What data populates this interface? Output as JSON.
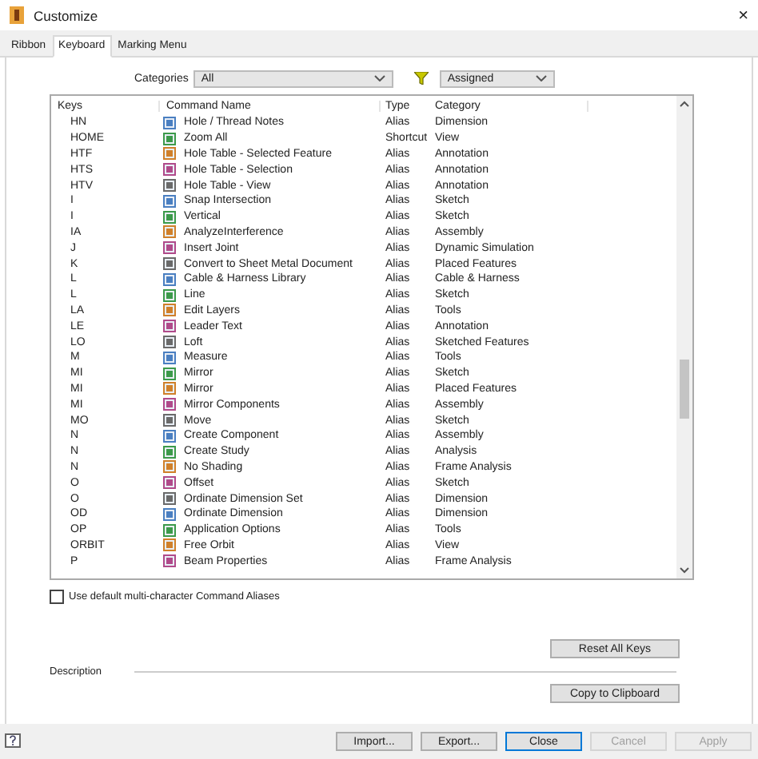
{
  "window": {
    "title": "Customize",
    "close": "×"
  },
  "tabs": [
    {
      "label": "Ribbon",
      "selected": false
    },
    {
      "label": "Keyboard",
      "selected": true
    },
    {
      "label": "Marking Menu",
      "selected": false
    }
  ],
  "categories": {
    "label": "Categories",
    "value": "All"
  },
  "filter": {
    "value": "Assigned"
  },
  "table": {
    "columns": [
      "Keys",
      "Command Name",
      "Type",
      "Category"
    ],
    "rows": [
      {
        "keys": "HN",
        "command": "Hole / Thread Notes",
        "type": "Alias",
        "category": "Dimension"
      },
      {
        "keys": "HOME",
        "command": "Zoom All",
        "type": "Shortcut",
        "category": "View"
      },
      {
        "keys": "HTF",
        "command": "Hole Table - Selected Feature",
        "type": "Alias",
        "category": "Annotation"
      },
      {
        "keys": "HTS",
        "command": "Hole Table - Selection",
        "type": "Alias",
        "category": "Annotation"
      },
      {
        "keys": "HTV",
        "command": "Hole Table - View",
        "type": "Alias",
        "category": "Annotation"
      },
      {
        "keys": "I",
        "command": "Snap Intersection",
        "type": "Alias",
        "category": "Sketch"
      },
      {
        "keys": "I",
        "command": "Vertical",
        "type": "Alias",
        "category": "Sketch"
      },
      {
        "keys": "IA",
        "command": "AnalyzeInterference",
        "type": "Alias",
        "category": "Assembly"
      },
      {
        "keys": "J",
        "command": "Insert Joint",
        "type": "Alias",
        "category": "Dynamic Simulation"
      },
      {
        "keys": "K",
        "command": "Convert to Sheet Metal Document",
        "type": "Alias",
        "category": "Placed Features"
      },
      {
        "keys": "L",
        "command": "Cable & Harness Library",
        "type": "Alias",
        "category": "Cable & Harness"
      },
      {
        "keys": "L",
        "command": "Line",
        "type": "Alias",
        "category": "Sketch"
      },
      {
        "keys": "LA",
        "command": "Edit Layers",
        "type": "Alias",
        "category": "Tools"
      },
      {
        "keys": "LE",
        "command": "Leader Text",
        "type": "Alias",
        "category": "Annotation"
      },
      {
        "keys": "LO",
        "command": "Loft",
        "type": "Alias",
        "category": "Sketched Features"
      },
      {
        "keys": "M",
        "command": "Measure",
        "type": "Alias",
        "category": "Tools"
      },
      {
        "keys": "MI",
        "command": "Mirror",
        "type": "Alias",
        "category": "Sketch"
      },
      {
        "keys": "MI",
        "command": "Mirror",
        "type": "Alias",
        "category": "Placed Features"
      },
      {
        "keys": "MI",
        "command": "Mirror Components",
        "type": "Alias",
        "category": "Assembly"
      },
      {
        "keys": "MO",
        "command": "Move",
        "type": "Alias",
        "category": "Sketch"
      },
      {
        "keys": "N",
        "command": "Create Component",
        "type": "Alias",
        "category": "Assembly"
      },
      {
        "keys": "N",
        "command": "Create Study",
        "type": "Alias",
        "category": "Analysis"
      },
      {
        "keys": "N",
        "command": "No Shading",
        "type": "Alias",
        "category": "Frame Analysis"
      },
      {
        "keys": "O",
        "command": "Offset",
        "type": "Alias",
        "category": "Sketch"
      },
      {
        "keys": "O",
        "command": "Ordinate Dimension Set",
        "type": "Alias",
        "category": "Dimension"
      },
      {
        "keys": "OD",
        "command": "Ordinate Dimension",
        "type": "Alias",
        "category": "Dimension"
      },
      {
        "keys": "OP",
        "command": "Application Options",
        "type": "Alias",
        "category": "Tools"
      },
      {
        "keys": "ORBIT",
        "command": "Free Orbit",
        "type": "Alias",
        "category": "View"
      },
      {
        "keys": "P",
        "command": "Beam Properties",
        "type": "Alias",
        "category": "Frame Analysis"
      }
    ]
  },
  "default_aliases": {
    "label": "Use default multi-character Command Aliases",
    "checked": false
  },
  "reset_button": "Reset All Keys",
  "description": {
    "label": "Description"
  },
  "copy_button": "Copy to Clipboard",
  "buttons": [
    {
      "label": "Import...",
      "disabled": false,
      "default": false
    },
    {
      "label": "Export...",
      "disabled": false,
      "default": false
    },
    {
      "label": "Close",
      "disabled": false,
      "default": true
    },
    {
      "label": "Cancel",
      "disabled": true,
      "default": false
    },
    {
      "label": "Apply",
      "disabled": true,
      "default": false
    }
  ]
}
